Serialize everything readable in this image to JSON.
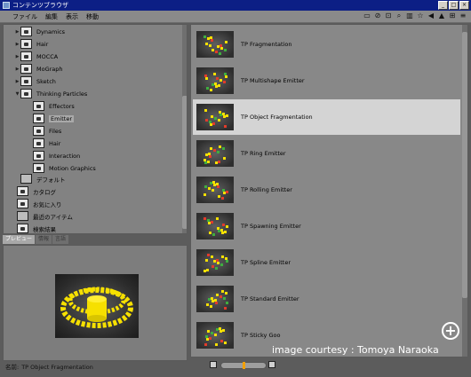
{
  "window": {
    "title": "コンテンツブラウザ"
  },
  "menu": [
    "ファイル",
    "編集",
    "表示",
    "移動"
  ],
  "toolbar_icons": [
    "window-icon",
    "pin-icon",
    "lock-icon",
    "search-icon",
    "bookmark-icon",
    "star-icon",
    "back-icon",
    "up-icon",
    "view-icon",
    "list-icon"
  ],
  "tree": [
    {
      "label": "Dynamics",
      "level": 1,
      "expander": "right"
    },
    {
      "label": "Hair",
      "level": 1,
      "expander": "right"
    },
    {
      "label": "MOCCA",
      "level": 1,
      "expander": "right"
    },
    {
      "label": "MoGraph",
      "level": 1,
      "expander": "right"
    },
    {
      "label": "Sketch",
      "level": 1,
      "expander": "right"
    },
    {
      "label": "Thinking Particles",
      "level": 1,
      "expander": "down"
    },
    {
      "label": "Effectors",
      "level": 2,
      "expander": ""
    },
    {
      "label": "Emitter",
      "level": 2,
      "expander": "",
      "selected": true
    },
    {
      "label": "Files",
      "level": 2,
      "expander": ""
    },
    {
      "label": "Hair",
      "level": 2,
      "expander": ""
    },
    {
      "label": "Interaction",
      "level": 2,
      "expander": ""
    },
    {
      "label": "Motion Graphics",
      "level": 2,
      "expander": ""
    },
    {
      "label": "デフォルト",
      "level": 1,
      "expander": "",
      "folder": true
    },
    {
      "label": "カタログ",
      "level": 0,
      "expander": ""
    },
    {
      "label": "お気に入り",
      "level": 0,
      "expander": ""
    },
    {
      "label": "最近のアイテム",
      "level": 0,
      "expander": "",
      "folder": true
    },
    {
      "label": "検索結果",
      "level": 0,
      "expander": ""
    }
  ],
  "tabs": [
    "プレビュー",
    "情報",
    "言語"
  ],
  "name_label": "名前:",
  "name_value": "TP Object Fragmentation",
  "items": [
    {
      "label": "TP Fragmentation"
    },
    {
      "label": "TP Multishape Emitter"
    },
    {
      "label": "TP Object Fragmentation",
      "selected": true
    },
    {
      "label": "TP Ring Emitter"
    },
    {
      "label": "TP Rolling Emitter"
    },
    {
      "label": "TP Spawning Emitter"
    },
    {
      "label": "TP Spline Emitter"
    },
    {
      "label": "TP Standard Emitter"
    },
    {
      "label": "TP Sticky Goo"
    }
  ],
  "courtesy": "image courtesy : Tomoya Naraoka",
  "colors": {
    "title_bar": "#0c1f85",
    "selection": "#d4d4d4",
    "particles": "#f6e000",
    "slider_knob": "#f2a000"
  }
}
